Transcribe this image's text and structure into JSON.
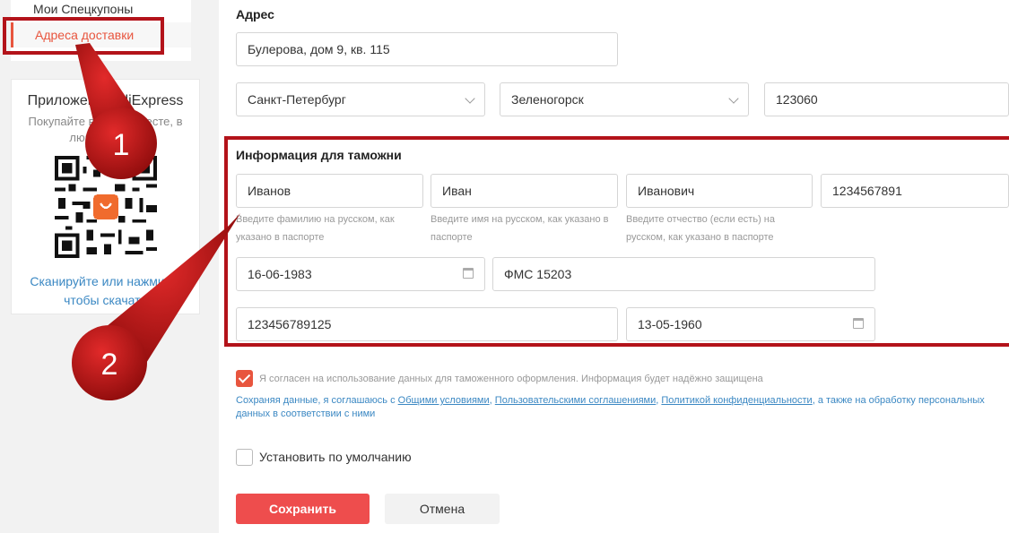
{
  "sidebar": {
    "menu_items": [
      {
        "label": "Мои Спецкупоны"
      },
      {
        "label": "Адреса доставки"
      }
    ],
    "app_promo": {
      "title": "Приложение AliExpress",
      "subtitle": "Покупайте в любом месте, в любое время",
      "link": "Сканируйте или нажмите, чтобы скачать"
    }
  },
  "address": {
    "section_label": "Адрес",
    "street": "Булерова, дом 9, кв. 115",
    "region": "Санкт-Петербург",
    "city": "Зеленогорск",
    "zip": "123060"
  },
  "customs": {
    "section_label": "Информация для таможни",
    "last_name": "Иванов",
    "first_name": "Иван",
    "middle_name": "Иванович",
    "phone": "1234567891",
    "hint_last_name": "Введите фамилию на русском, как указано в паспорте",
    "hint_first_name": "Введите имя на русском, как указано в паспорте",
    "hint_middle_name": "Введите отчество (если есть) на русском, как указано в паспорте",
    "birth_date": "16-06-1983",
    "issued_by": "ФМС 15203",
    "passport_number": "123456789125",
    "issue_date": "13-05-1960"
  },
  "consent": {
    "checked": true,
    "text": "Я согласен на использование данных для таможенного оформления. Информация будет надёжно защищена",
    "terms_prefix": "Сохраняя данные, я соглашаюсь с ",
    "terms_link_1": "Общими условиями",
    "terms_sep_1": ", ",
    "terms_link_2": "Пользовательскими соглашениями",
    "terms_sep_2": ", ",
    "terms_link_3": "Политикой конфиденциальности",
    "terms_suffix": ", а также на обработку персональных данных в соответствии с ними"
  },
  "default_option": {
    "checked": false,
    "label": "Установить по умолчанию"
  },
  "buttons": {
    "save": "Сохранить",
    "cancel": "Отмена"
  },
  "annotations": {
    "marker_1": "1",
    "marker_2": "2",
    "color": "#b3131a"
  },
  "colors": {
    "accent": "#e8553e",
    "save_button": "#ee4d4d",
    "link": "#3b88c3"
  }
}
